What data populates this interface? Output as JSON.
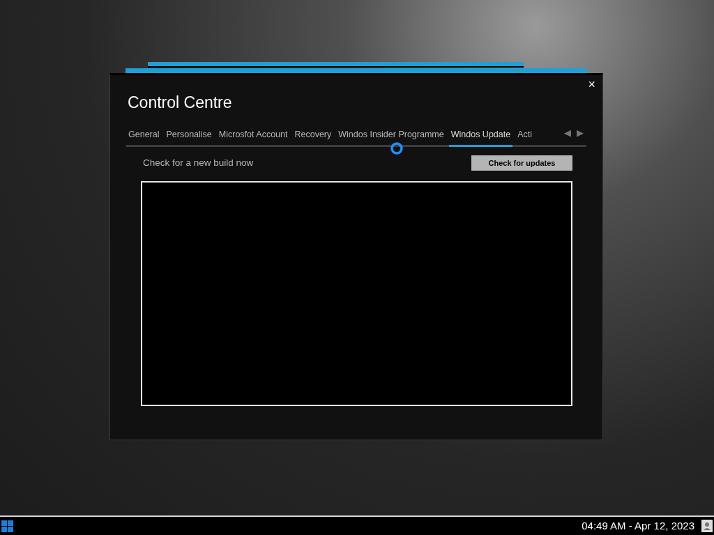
{
  "window": {
    "title": "Control Centre",
    "close": "×"
  },
  "tabs": [
    {
      "label": "General",
      "selected": false
    },
    {
      "label": "Personalise",
      "selected": false
    },
    {
      "label": "Microsfot Account",
      "selected": false
    },
    {
      "label": "Recovery",
      "selected": false
    },
    {
      "label": "Windos Insider Programme",
      "selected": false
    },
    {
      "label": "Windos Update",
      "selected": true
    },
    {
      "label": "Acti",
      "selected": false
    }
  ],
  "tab_scroll": {
    "left": "◀",
    "right": "▶"
  },
  "content": {
    "prompt": "Check for a new build now",
    "button": "Check for updates"
  },
  "taskbar": {
    "clock": "04:49 AM - Apr 12, 2023"
  }
}
